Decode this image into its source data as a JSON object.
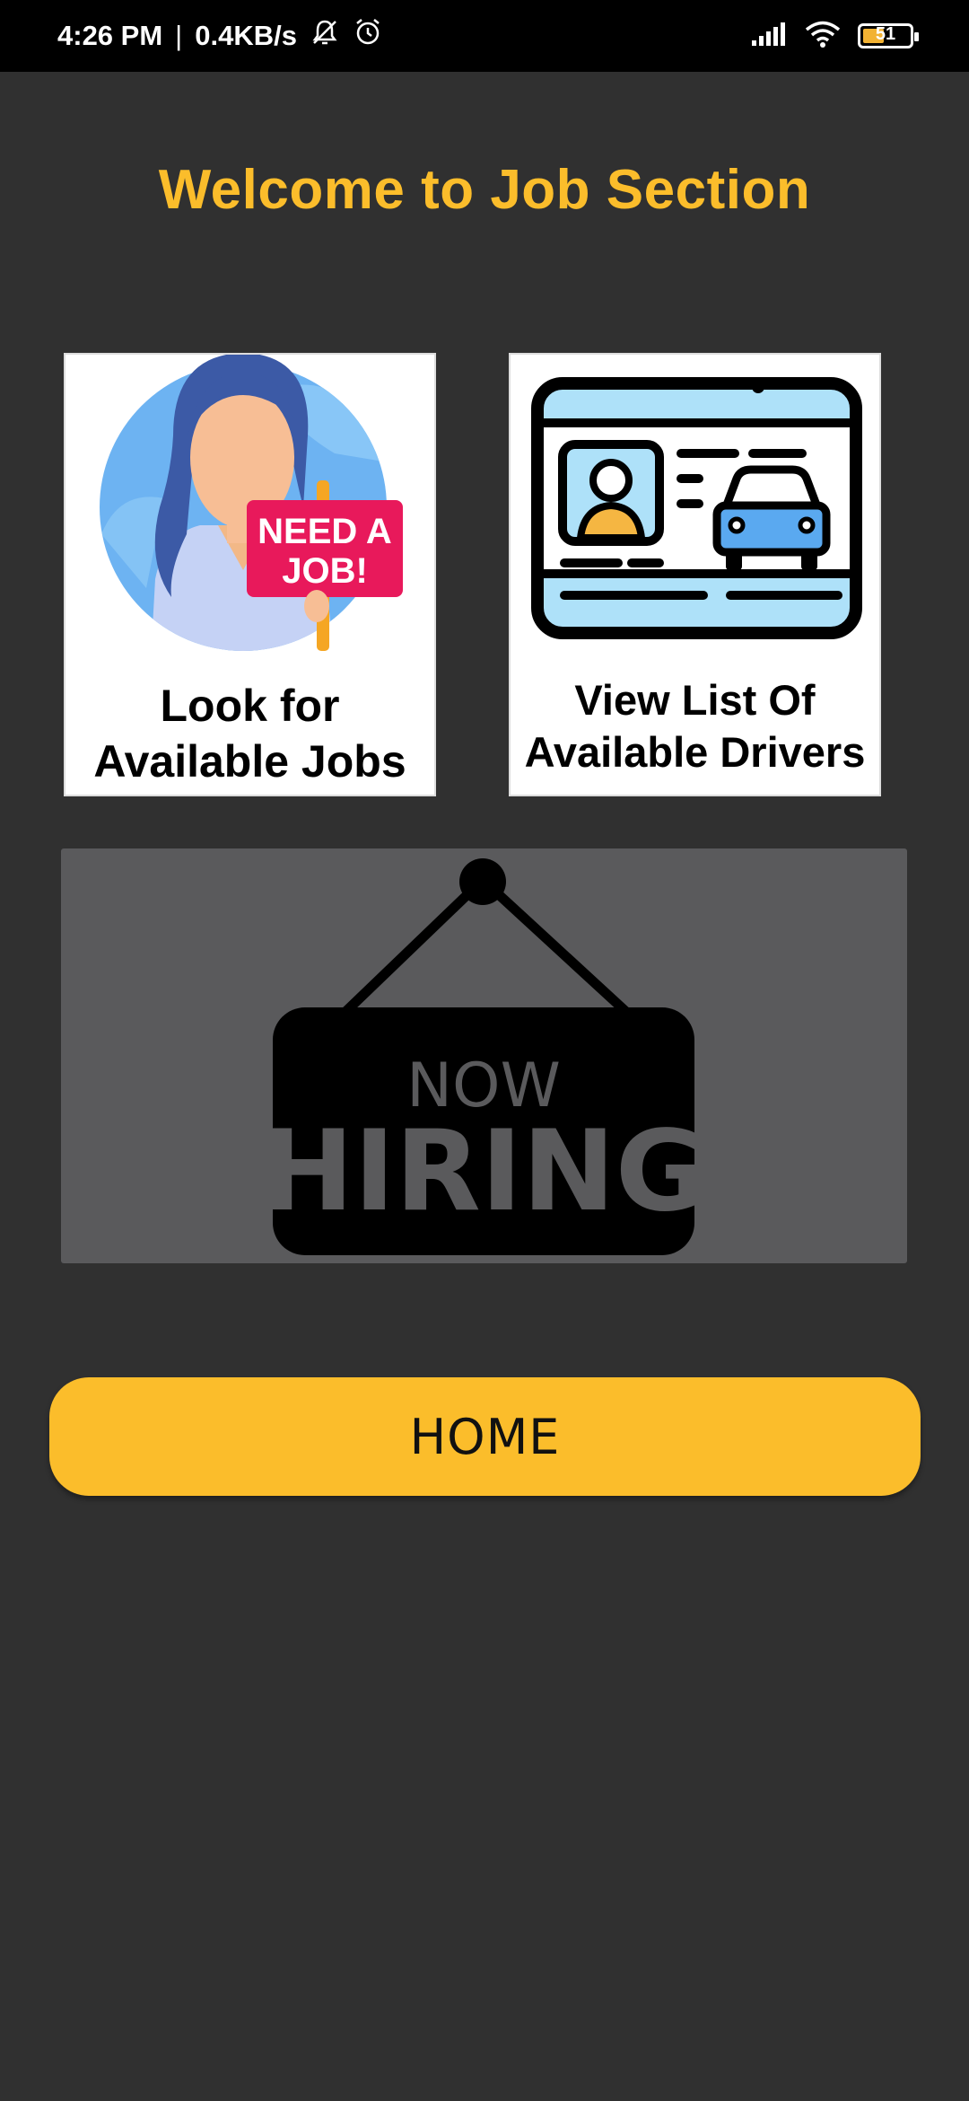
{
  "status_bar": {
    "time": "4:26 PM",
    "separator": "|",
    "speed": "0.4KB/s",
    "battery": "51",
    "battery_level": 0.51,
    "icons": [
      "mute-icon",
      "alarm-icon",
      "signal-icon",
      "wifi-icon",
      "battery-icon"
    ]
  },
  "title": "Welcome to Job Section",
  "cards": {
    "jobs": {
      "label": "Look for\nAvailable Jobs",
      "sign_line1": "NEED A",
      "sign_line2": "JOB!"
    },
    "drivers": {
      "label": "View List Of\nAvailable Drivers"
    }
  },
  "banner": {
    "line1": "NOW",
    "line2": "HIRING"
  },
  "home_button": "HOME",
  "colors": {
    "background": "#303030",
    "accent": "#fbbd2b",
    "banner": "#5a5a5c"
  }
}
